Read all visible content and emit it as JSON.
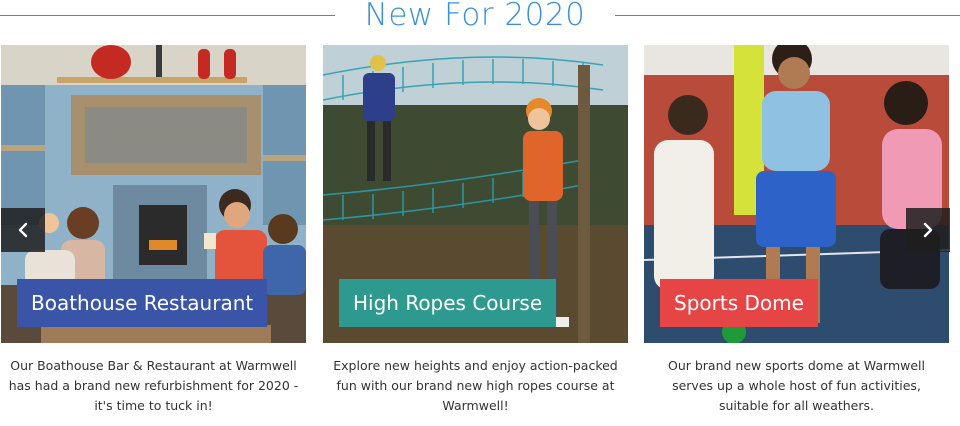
{
  "section": {
    "title": "New For 2020"
  },
  "cards": [
    {
      "label": "Boathouse Restaurant",
      "label_color": "#3a55a8",
      "description": "Our Boathouse Bar & Restaurant at Warmwell has had a brand new refurbishment for 2020 - it's time to tuck in!"
    },
    {
      "label": "High Ropes Course",
      "label_color": "#2e9a8f",
      "description": "Explore new heights and enjoy action-packed fun with our brand new high ropes course at Warmwell!"
    },
    {
      "label": "Sports Dome",
      "label_color": "#e64545",
      "description": "Our brand new sports dome at Warmwell serves up a whole host of fun activities, suitable for all weathers."
    }
  ],
  "carousel": {
    "prev_icon": "chevron-left-icon",
    "next_icon": "chevron-right-icon"
  }
}
